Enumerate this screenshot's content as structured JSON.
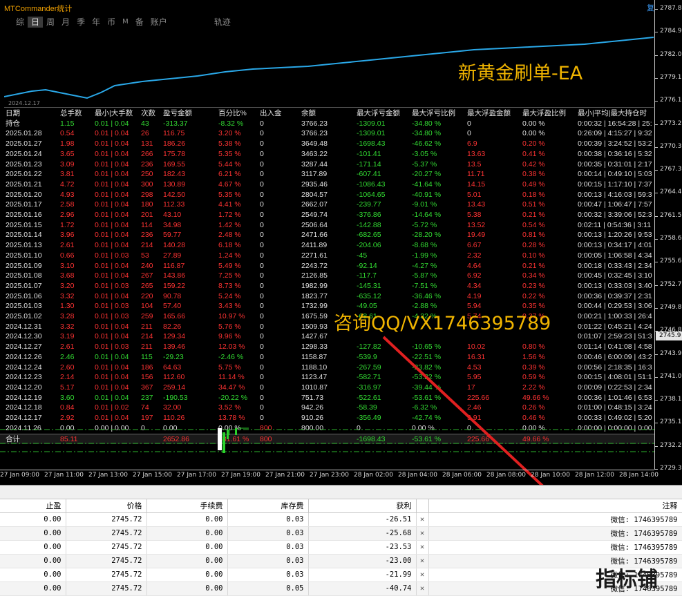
{
  "app_title": "MTCommander统计",
  "corner_icon": "复",
  "period_tabs": [
    "综",
    "日",
    "周",
    "月",
    "季",
    "年",
    "币",
    "M",
    "备",
    "账户",
    "轨迹"
  ],
  "active_tab": "日",
  "equity_start_date": "2024.12.17",
  "watermark_title": "新黄金刷单-EA",
  "contact_text": "咨询QQ/VX1746395789",
  "colors": {
    "equity_line": "#2aa8e8",
    "positive": "#33dd33",
    "negative": "#ff3333",
    "accent": "#f0b400",
    "arrow": "#e02020"
  },
  "stats": {
    "headers": [
      "日期",
      "总手数",
      "最小|大手数",
      "次数",
      "盈亏金额",
      "百分比%",
      "出入金",
      "余额",
      "最大浮亏金额",
      "最大浮亏比例",
      "最大浮盈金额",
      "最大浮盈比例",
      "最小|平均|最大持仓时"
    ],
    "holding": [
      "持仓",
      "1.15",
      "0.01 | 0.04",
      "43",
      "-313.37",
      "-8.32 %",
      "0",
      "3766.23",
      "-1309.01",
      "-34.80 %",
      "0",
      "0.00 %",
      "0:00:32 | 16:54:28 | 25:"
    ],
    "rows": [
      [
        "2025.01.28",
        "0.54",
        "0.01 | 0.04",
        "26",
        "116.75",
        "3.20 %",
        "0",
        "3766.23",
        "-1309.01",
        "-34.80 %",
        "0",
        "0.00 %",
        "0:26:09 | 4:15:27 | 9:32"
      ],
      [
        "2025.01.27",
        "1.98",
        "0.01 | 0.04",
        "131",
        "186.26",
        "5.38 %",
        "0",
        "3649.48",
        "-1698.43",
        "-46.62 %",
        "6.9",
        "0.20 %",
        "0:00:39 | 3:24:52 | 53:2"
      ],
      [
        "2025.01.24",
        "3.65",
        "0.01 | 0.04",
        "266",
        "175.78",
        "5.35 %",
        "0",
        "3463.22",
        "-101.41",
        "-3.05 %",
        "13.63",
        "0.41 %",
        "0:00:38 | 0:36:16 | 5:32"
      ],
      [
        "2025.01.23",
        "3.09",
        "0.01 | 0.04",
        "236",
        "169.55",
        "5.44 %",
        "0",
        "3287.44",
        "-171.14",
        "-5.37 %",
        "13.5",
        "0.42 %",
        "0:00:35 | 0:31:01 | 2:17"
      ],
      [
        "2025.01.22",
        "3.81",
        "0.01 | 0.04",
        "250",
        "182.43",
        "6.21 %",
        "0",
        "3117.89",
        "-607.41",
        "-20.27 %",
        "11.71",
        "0.38 %",
        "0:00:14 | 0:49:10 | 5:03"
      ],
      [
        "2025.01.21",
        "4.72",
        "0.01 | 0.04",
        "300",
        "130.89",
        "4.67 %",
        "0",
        "2935.46",
        "-1086.43",
        "-41.64 %",
        "14.15",
        "0.49 %",
        "0:00:15 | 1:17:10 | 7:37"
      ],
      [
        "2025.01.20",
        "4.93",
        "0.01 | 0.04",
        "298",
        "142.50",
        "5.35 %",
        "0",
        "2804.57",
        "-1064.65",
        "-40.91 %",
        "5.01",
        "0.18 %",
        "0:00:13 | 4:16:03 | 59:3"
      ],
      [
        "2025.01.17",
        "2.58",
        "0.01 | 0.04",
        "180",
        "112.33",
        "4.41 %",
        "0",
        "2662.07",
        "-239.77",
        "-9.01 %",
        "13.43",
        "0.51 %",
        "0:00:47 | 1:06:47 | 7:57"
      ],
      [
        "2025.01.16",
        "2.96",
        "0.01 | 0.04",
        "201",
        "43.10",
        "1.72 %",
        "0",
        "2549.74",
        "-376.86",
        "-14.64 %",
        "5.38",
        "0.21 %",
        "0:00:32 | 3:39:06 | 52:3"
      ],
      [
        "2025.01.15",
        "1.72",
        "0.01 | 0.04",
        "114",
        "34.98",
        "1.42 %",
        "0",
        "2506.64",
        "-142.88",
        "-5.72 %",
        "13.52",
        "0.54 %",
        "0:02:11 | 0:54:36 | 3:11"
      ],
      [
        "2025.01.14",
        "3.96",
        "0.01 | 0.04",
        "236",
        "59.77",
        "2.48 %",
        "0",
        "2471.66",
        "-682.65",
        "-28.20 %",
        "19.49",
        "0.81 %",
        "0:00:13 | 1:20:26 | 9:53"
      ],
      [
        "2025.01.13",
        "2.61",
        "0.01 | 0.04",
        "214",
        "140.28",
        "6.18 %",
        "0",
        "2411.89",
        "-204.06",
        "-8.68 %",
        "6.67",
        "0.28 %",
        "0:00:13 | 0:34:17 | 4:01"
      ],
      [
        "2025.01.10",
        "0.66",
        "0.01 | 0.03",
        "53",
        "27.89",
        "1.24 %",
        "0",
        "2271.61",
        "-45",
        "-1.99 %",
        "2.32",
        "0.10 %",
        "0:00:05 | 1:06:58 | 4:34"
      ],
      [
        "2025.01.09",
        "3.10",
        "0.01 | 0.04",
        "240",
        "116.87",
        "5.49 %",
        "0",
        "2243.72",
        "-92.14",
        "-4.27 %",
        "4.64",
        "0.21 %",
        "0:00:18 | 0:33:43 | 2:34"
      ],
      [
        "2025.01.08",
        "3.68",
        "0.01 | 0.04",
        "267",
        "143.86",
        "7.25 %",
        "0",
        "2126.85",
        "-117.7",
        "-5.87 %",
        "6.92",
        "0.34 %",
        "0:00:45 | 0:32:45 | 3:10"
      ],
      [
        "2025.01.07",
        "3.20",
        "0.01 | 0.03",
        "265",
        "159.22",
        "8.73 %",
        "0",
        "1982.99",
        "-145.31",
        "-7.51 %",
        "4.34",
        "0.23 %",
        "0:00:13 | 0:33:03 | 3:40"
      ],
      [
        "2025.01.06",
        "3.32",
        "0.01 | 0.04",
        "220",
        "90.78",
        "5.24 %",
        "0",
        "1823.77",
        "-635.12",
        "-36.46 %",
        "4.19",
        "0.22 %",
        "0:00:36 | 0:39:37 | 2:31"
      ],
      [
        "2025.01.03",
        "1.30",
        "0.01 | 0.03",
        "104",
        "57.40",
        "3.43 %",
        "0",
        "1732.99",
        "-49.05",
        "-2.88 %",
        "5.94",
        "0.35 %",
        "0:00:44 | 0:29:53 | 3:06"
      ],
      [
        "2025.01.02",
        "3.28",
        "0.01 | 0.03",
        "259",
        "165.66",
        "10.97 %",
        "0",
        "1675.59",
        "-68.61",
        "-4.32 %",
        "5.74",
        "0.37 %",
        "0:00:21 | 1:00:33 | 26:4"
      ],
      [
        "2024.12.31",
        "3.32",
        "0.01 | 0.04",
        "211",
        "82.26",
        "5.76 %",
        "0",
        "1509.93",
        "",
        "",
        "",
        "",
        "0:01:22 | 0:45:21 | 4:24"
      ],
      [
        "2024.12.30",
        "3.19",
        "0.01 | 0.04",
        "214",
        "129.34",
        "9.96 %",
        "0",
        "1427.67",
        "",
        "",
        "",
        "",
        "0:01:07 | 2:59:23 | 51:3"
      ],
      [
        "2024.12.27",
        "2.61",
        "0.01 | 0.03",
        "211",
        "139.46",
        "12.03 %",
        "0",
        "1298.33",
        "-127.82",
        "-10.65 %",
        "10.02",
        "0.80 %",
        "0:01:14 | 0:41:08 | 4:58"
      ],
      [
        "2024.12.26",
        "2.46",
        "0.01 | 0.04",
        "115",
        "-29.23",
        "-2.46 %",
        "0",
        "1158.87",
        "-539.9",
        "-22.51 %",
        "16.31",
        "1.56 %",
        "0:00:46 | 6:00:09 | 43:2"
      ],
      [
        "2024.12.24",
        "2.60",
        "0.01 | 0.04",
        "186",
        "64.63",
        "5.75 %",
        "0",
        "1188.10",
        "-267.59",
        "-23.82 %",
        "4.53",
        "0.39 %",
        "0:00:56 | 2:18:35 | 16:3"
      ],
      [
        "2024.12.23",
        "2.14",
        "0.01 | 0.04",
        "156",
        "112.60",
        "11.14 %",
        "0",
        "1123.47",
        "-582.71",
        "-53.22 %",
        "5.95",
        "0.59 %",
        "0:00:15 | 4:08:01 | 51:1"
      ],
      [
        "2024.12.20",
        "5.17",
        "0.01 | 0.04",
        "367",
        "259.14",
        "34.47 %",
        "0",
        "1010.87",
        "-316.97",
        "-39.44 %",
        "17",
        "2.22 %",
        "0:00:09 | 0:22:53 | 2:34"
      ],
      [
        "2024.12.19",
        "3.60",
        "0.01 | 0.04",
        "237",
        "-190.53",
        "-20.22 %",
        "0",
        "751.73",
        "-522.61",
        "-53.61 %",
        "225.66",
        "49.66 %",
        "0:00:36 | 1:01:46 | 6:53"
      ],
      [
        "2024.12.18",
        "0.84",
        "0.01 | 0.02",
        "74",
        "32.00",
        "3.52 %",
        "0",
        "942.26",
        "-58.39",
        "-6.32 %",
        "2.46",
        "0.26 %",
        "0:01:00 | 0:48:15 | 3:24"
      ],
      [
        "2024.12.17",
        "2.92",
        "0.01 | 0.04",
        "197",
        "110.26",
        "13.78 %",
        "0",
        "910.26",
        "-356.49",
        "-42.74 %",
        "3.91",
        "0.46 %",
        "0:00:33 | 0:49:02 | 5:20"
      ],
      [
        "2024.11.26",
        "0.00",
        "0.00 | 0.00",
        "0",
        "0.00",
        "0.00 %",
        "800",
        "800.00",
        "0",
        "0.00 %",
        "0",
        "0.00 %",
        "0:00:00 | 0:00:00 | 0:00"
      ]
    ],
    "total": [
      "合计",
      "85.11",
      "",
      "",
      "2652.86",
      "331.61 %",
      "800",
      "",
      "-1698.43",
      "-53.61 %",
      "225.66",
      "49.66 %",
      ""
    ]
  },
  "price_scale": [
    "2787.8",
    "2784.9",
    "2782.0",
    "2779.1",
    "2776.1",
    "2773.2",
    "2770.3",
    "2767.3",
    "2764.4",
    "2761.5",
    "2758.6",
    "2755.6",
    "2752.7",
    "2749.8",
    "2746.8",
    "2743.9",
    "2741.0",
    "2738.1",
    "2735.1",
    "2732.2",
    "2729.3"
  ],
  "current_price": "2745.9",
  "time_axis": [
    "27 Jan 09:00",
    "27 Jan 11:00",
    "27 Jan 13:00",
    "27 Jan 15:00",
    "27 Jan 17:00",
    "27 Jan 19:00",
    "27 Jan 21:00",
    "27 Jan 23:00",
    "28 Jan 02:00",
    "28 Jan 04:00",
    "28 Jan 06:00",
    "28 Jan 08:00",
    "28 Jan 10:00",
    "28 Jan 12:00",
    "28 Jan 14:00"
  ],
  "orders": {
    "headers": [
      "止盈",
      "价格",
      "手续费",
      "库存费",
      "获利",
      "",
      "注释"
    ],
    "rows": [
      [
        "0.00",
        "2745.72",
        "0.00",
        "0.03",
        "-26.51",
        "✕",
        "微信: 1746395789"
      ],
      [
        "0.00",
        "2745.72",
        "0.00",
        "0.03",
        "-25.68",
        "✕",
        "微信: 1746395789"
      ],
      [
        "0.00",
        "2745.72",
        "0.00",
        "0.03",
        "-23.53",
        "✕",
        "微信: 1746395789"
      ],
      [
        "0.00",
        "2745.72",
        "0.00",
        "0.03",
        "-23.00",
        "✕",
        "微信: 1746395789"
      ],
      [
        "0.00",
        "2745.72",
        "0.00",
        "0.03",
        "-21.99",
        "✕",
        "微信: 1746395789"
      ],
      [
        "0.00",
        "2745.72",
        "0.00",
        "0.05",
        "-40.74",
        "✕",
        "微信: 1746395789"
      ]
    ]
  },
  "orders_watermark": "指标铺"
}
